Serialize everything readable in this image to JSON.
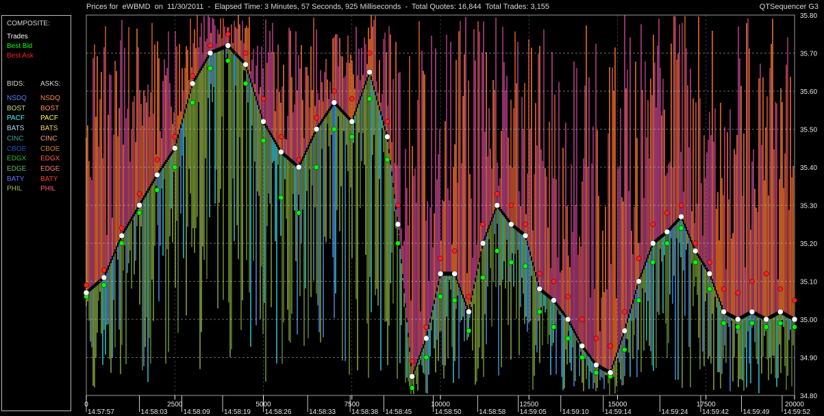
{
  "header": {
    "title": "Prices for  eWBMD  on  11/30/2011  -  Elapsed Time: 3 Minutes, 57 Seconds, 925 Milliseconds  -  Total Quotes: 16,844  Total Trades: 3,155",
    "app_name": "QTSequencer G3"
  },
  "legend": {
    "composite_label": "COMPOSITE:",
    "composite": [
      {
        "label": "Trades",
        "color": "#ffffff"
      },
      {
        "label": "Best Bid",
        "color": "#00ff00"
      },
      {
        "label": "Best Ask",
        "color": "#ff2020"
      }
    ],
    "bids_label": "BIDS:",
    "asks_label": "ASKS:",
    "bids": [
      {
        "label": "NSDQ",
        "color": "#4a7fff"
      },
      {
        "label": "BOST",
        "color": "#c8e070"
      },
      {
        "label": "PACF",
        "color": "#40ffff"
      },
      {
        "label": "BATS",
        "color": "#b0d8ff"
      },
      {
        "label": "CINC",
        "color": "#40a0a0"
      },
      {
        "label": "CBOE",
        "color": "#2050c0"
      },
      {
        "label": "EDGX",
        "color": "#20c020"
      },
      {
        "label": "EDGE",
        "color": "#60c060"
      },
      {
        "label": "BATY",
        "color": "#6070ff"
      },
      {
        "label": "PHIL",
        "color": "#a0c040"
      }
    ],
    "asks": [
      {
        "label": "NSDQ",
        "color": "#ff8040"
      },
      {
        "label": "BOST",
        "color": "#ff9060"
      },
      {
        "label": "PACF",
        "color": "#ffff40"
      },
      {
        "label": "BATS",
        "color": "#ffd060"
      },
      {
        "label": "CINC",
        "color": "#ff9a80"
      },
      {
        "label": "CBOE",
        "color": "#d08020"
      },
      {
        "label": "EDGX",
        "color": "#ff6040"
      },
      {
        "label": "EDGE",
        "color": "#ff8070"
      },
      {
        "label": "BATY",
        "color": "#ff4020"
      },
      {
        "label": "PHIL",
        "color": "#ff6080"
      }
    ]
  },
  "chart_data": {
    "type": "scatter",
    "title": "",
    "ylim": [
      34.8,
      35.8
    ],
    "y_ticks": [
      "35.80",
      "35.70",
      "35.60",
      "35.50",
      "35.40",
      "35.30",
      "35.20",
      "35.10",
      "35.00",
      "34.90",
      "34.80"
    ],
    "xlim": [
      0,
      20000
    ],
    "x_ticks": [
      "0",
      "2500",
      "5000",
      "7500",
      "10000",
      "12500",
      "15000",
      "17500",
      "20000"
    ],
    "time_labels": [
      {
        "x": 0,
        "label": "14:57:57"
      },
      {
        "x": 1500,
        "label": "14:58:03"
      },
      {
        "x": 2700,
        "label": "14:58:09"
      },
      {
        "x": 3850,
        "label": "14:58:19"
      },
      {
        "x": 5000,
        "label": "14:58:26"
      },
      {
        "x": 6250,
        "label": "14:58:33"
      },
      {
        "x": 7450,
        "label": "14:58:38"
      },
      {
        "x": 8400,
        "label": "14:58:45"
      },
      {
        "x": 9800,
        "label": "14:58:50"
      },
      {
        "x": 11050,
        "label": "14:58:58"
      },
      {
        "x": 12200,
        "label": "14:59:05"
      },
      {
        "x": 13400,
        "label": "14:59:10"
      },
      {
        "x": 14600,
        "label": "14:59:14"
      },
      {
        "x": 16200,
        "label": "14:59:24"
      },
      {
        "x": 17350,
        "label": "14:59:42"
      },
      {
        "x": 18500,
        "label": "14:59:49"
      },
      {
        "x": 19650,
        "label": "14:59:52"
      }
    ],
    "grid": true,
    "series": [
      {
        "name": "Trades",
        "color": "#ffffff",
        "x": [
          0,
          500,
          1000,
          1500,
          2000,
          2500,
          3000,
          3500,
          4000,
          4500,
          5000,
          5500,
          6000,
          6500,
          7000,
          7500,
          8000,
          8500,
          8800,
          9200,
          9600,
          10000,
          10400,
          10800,
          11200,
          11600,
          12000,
          12400,
          12800,
          13200,
          13600,
          14000,
          14400,
          14800,
          15200,
          15600,
          16000,
          16400,
          16800,
          17200,
          17600,
          18000,
          18400,
          18800,
          19200,
          19600,
          20000
        ],
        "y": [
          35.07,
          35.11,
          35.22,
          35.3,
          35.38,
          35.45,
          35.62,
          35.7,
          35.72,
          35.67,
          35.52,
          35.44,
          35.4,
          35.5,
          35.57,
          35.52,
          35.65,
          35.48,
          35.25,
          34.85,
          34.95,
          35.12,
          35.12,
          35.02,
          35.2,
          35.3,
          35.25,
          35.22,
          35.08,
          35.05,
          35.0,
          34.93,
          34.88,
          34.86,
          34.97,
          35.1,
          35.2,
          35.23,
          35.27,
          35.18,
          35.12,
          35.02,
          35.0,
          35.02,
          35.0,
          35.02,
          35.0
        ]
      },
      {
        "name": "Best Bid",
        "color": "#00ff00",
        "x": [
          0,
          500,
          1000,
          1500,
          2000,
          2500,
          3000,
          3500,
          4000,
          4500,
          5000,
          5500,
          6000,
          6500,
          7000,
          7500,
          8000,
          8500,
          8800,
          9200,
          9600,
          10000,
          10400,
          10800,
          11200,
          11600,
          12000,
          12400,
          12800,
          13200,
          13600,
          14000,
          14400,
          14800,
          15200,
          15600,
          16000,
          16400,
          16800,
          17200,
          17600,
          18000,
          18400,
          18800,
          19200,
          19600,
          20000
        ],
        "y": [
          35.06,
          35.09,
          35.2,
          35.28,
          35.34,
          35.4,
          35.57,
          35.66,
          35.68,
          35.62,
          35.47,
          35.32,
          35.28,
          35.4,
          35.5,
          35.48,
          35.58,
          35.42,
          35.2,
          34.82,
          34.9,
          35.06,
          35.05,
          34.97,
          35.11,
          35.18,
          35.15,
          35.14,
          35.02,
          34.98,
          34.95,
          34.9,
          34.86,
          34.85,
          34.92,
          35.05,
          35.15,
          35.2,
          35.24,
          35.15,
          35.08,
          34.99,
          34.98,
          34.99,
          34.98,
          34.99,
          34.98
        ]
      },
      {
        "name": "Best Ask",
        "color": "#ff2020",
        "x": [
          0,
          500,
          1000,
          1500,
          2000,
          2500,
          3000,
          3500,
          4000,
          4500,
          5000,
          5500,
          6000,
          6500,
          7000,
          7500,
          8000,
          8500,
          8800,
          9200,
          9600,
          10000,
          10400,
          10800,
          11200,
          11600,
          12000,
          12400,
          12800,
          13200,
          13600,
          14000,
          14400,
          14800,
          15200,
          15600,
          16000,
          16400,
          16800,
          17200,
          17600,
          18000,
          18400,
          18800,
          19200,
          19600,
          20000
        ],
        "y": [
          35.09,
          35.13,
          35.24,
          35.33,
          35.42,
          35.48,
          35.64,
          35.72,
          35.75,
          35.7,
          35.58,
          35.48,
          35.42,
          35.53,
          35.6,
          35.58,
          35.7,
          35.52,
          35.3,
          34.89,
          34.98,
          35.16,
          35.18,
          35.06,
          35.25,
          35.33,
          35.3,
          35.25,
          35.12,
          35.1,
          35.06,
          35.0,
          34.95,
          34.93,
          35.02,
          35.16,
          35.25,
          35.28,
          35.3,
          35.2,
          35.15,
          35.08,
          35.07,
          35.1,
          35.12,
          35.08,
          35.05
        ]
      }
    ]
  }
}
